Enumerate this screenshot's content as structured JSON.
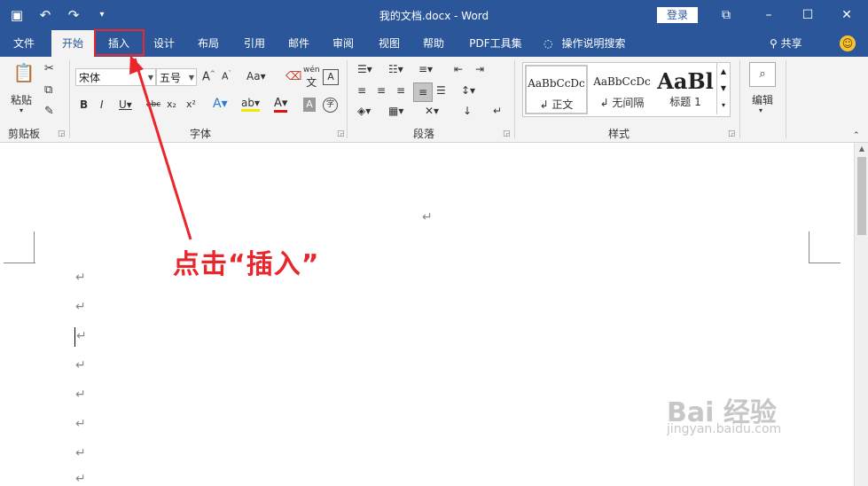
{
  "window": {
    "title": "我的文档.docx - Word",
    "login_label": "登录"
  },
  "tabs": [
    {
      "label": "文件"
    },
    {
      "label": "开始"
    },
    {
      "label": "插入"
    },
    {
      "label": "设计"
    },
    {
      "label": "布局"
    },
    {
      "label": "引用"
    },
    {
      "label": "邮件"
    },
    {
      "label": "审阅"
    },
    {
      "label": "视图"
    },
    {
      "label": "帮助"
    },
    {
      "label": "PDF工具集"
    }
  ],
  "tell_me": "操作说明搜索",
  "share_label": "共享",
  "ribbon": {
    "clipboard": {
      "paste_label": "粘贴",
      "group_label": "剪贴板"
    },
    "font": {
      "font_name": "宋体",
      "font_size": "五号",
      "group_label": "字体",
      "wen": "wén",
      "wen_char": "文"
    },
    "paragraph": {
      "group_label": "段落"
    },
    "styles": {
      "group_label": "样式",
      "items": [
        {
          "sample": "AaBbCcDc",
          "name": "↲ 正文"
        },
        {
          "sample": "AaBbCcDc",
          "name": "↲ 无间隔"
        },
        {
          "sample": "AaBl",
          "name": "标题 1"
        }
      ]
    },
    "editing": {
      "label": "编辑"
    }
  },
  "doc": {
    "mark": "↵"
  },
  "annotation": "点击“插入”",
  "watermark": {
    "line1": "Bai 经验",
    "line2": "jingyan.baidu.com"
  },
  "colors": {
    "accent": "#2b579a",
    "annotation": "#e8262b"
  }
}
